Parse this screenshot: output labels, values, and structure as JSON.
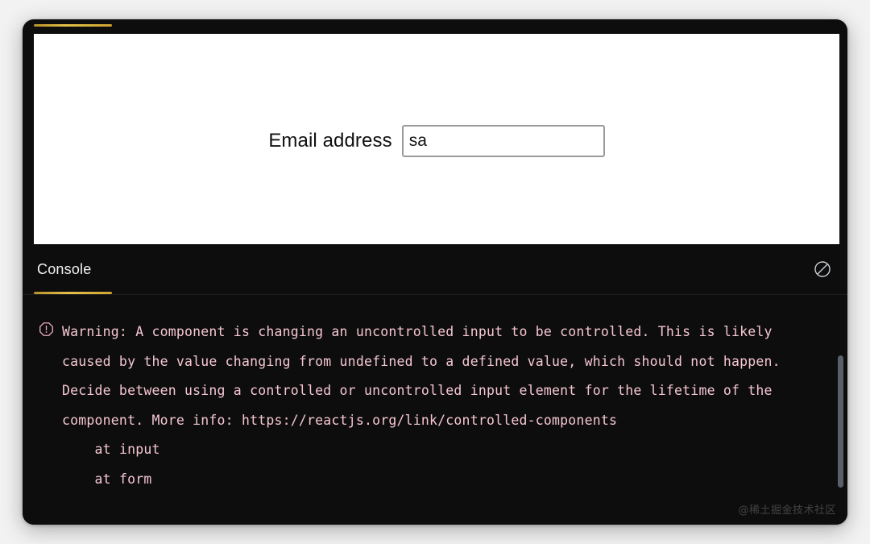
{
  "window": {
    "accent_color": "#d6ab2b",
    "frame_color": "#0d0d0d",
    "page_background": "#f2f2f2"
  },
  "app_preview": {
    "form": {
      "label": "Email address",
      "input_value": "sa",
      "input_placeholder": ""
    }
  },
  "devtools": {
    "tabs": [
      {
        "label": "Console",
        "active": true
      }
    ],
    "toolbar_actions": [
      {
        "name": "clear-console",
        "icon": "no-entry-icon",
        "tooltip": "Clear console"
      }
    ]
  },
  "console": {
    "entries": [
      {
        "level": "warning",
        "icon": "warning-octagon-icon",
        "text_color": "#f5c6d2",
        "message": "Warning: A component is changing an uncontrolled input to be controlled. This is likely caused by the value changing from undefined to a defined value, which should not happen. Decide between using a controlled or uncontrolled input element for the lifetime of the component. More info: https://reactjs.org/link/controlled-components\n    at input\n    at form"
      }
    ],
    "scrollbar": {
      "visible": true,
      "thumb_color": "#5a6069"
    }
  },
  "watermark": {
    "text": "@稀土掘金技术社区"
  }
}
